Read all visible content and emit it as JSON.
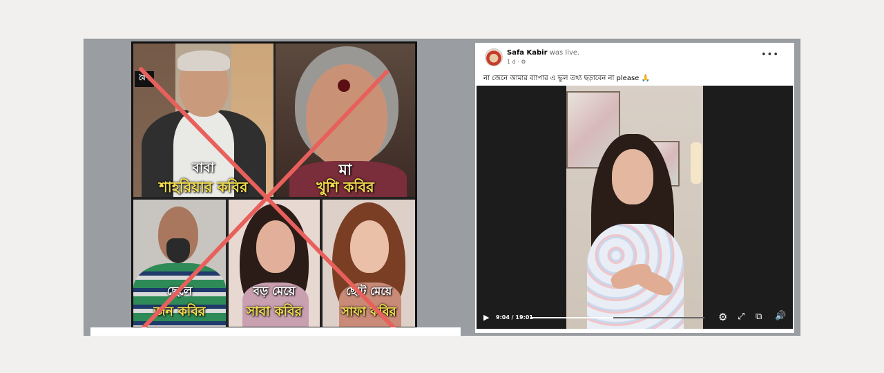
{
  "collage": {
    "news_tag": "বৈশ",
    "tiles": [
      {
        "role": "বাবা",
        "name": "শাহরিয়ার কবির"
      },
      {
        "role": "মা",
        "name": "খুশি কবির"
      },
      {
        "role": "ছেলে",
        "name": "জন কবির"
      },
      {
        "role": "বড় মেয়ে",
        "name": "সাবা কবির"
      },
      {
        "role": "ছোট মেয়ে",
        "name": "সাফা কবির"
      }
    ],
    "cross_color": "#e8605c"
  },
  "post": {
    "poster_name": "Safa Kabir",
    "status": "was live.",
    "time": "1 d ·",
    "more_icon": "more-dots-icon",
    "caption": "না জেনে আমার ব্যাপার এ ভুল তথ্য ছড়াবেন না please 🙏",
    "video": {
      "time_current": "9:04",
      "time_total": "19:01",
      "time_display": "9:04 / 19:01",
      "progress_fraction": 0.476,
      "icons": [
        "play-icon",
        "settings-icon",
        "fullscreen-icon",
        "pip-icon",
        "volume-icon"
      ]
    }
  }
}
